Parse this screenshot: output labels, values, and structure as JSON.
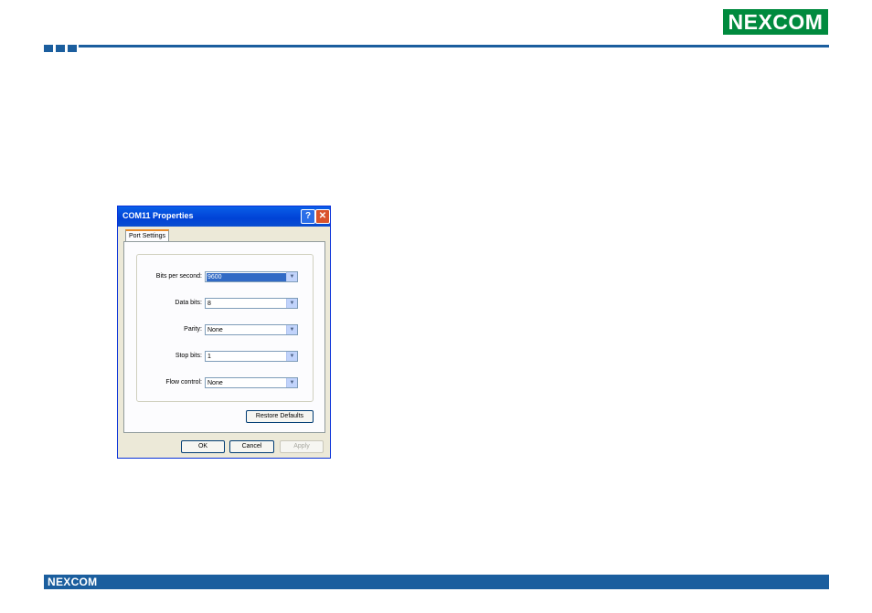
{
  "header": {
    "logo_text": "NEXCOM"
  },
  "footer": {
    "logo_text": "NEXCOM"
  },
  "dialog": {
    "title": "COM11 Properties",
    "help_glyph": "?",
    "close_glyph": "✕",
    "tab_label": "Port Settings",
    "fields": {
      "bits_per_second": {
        "label": "Bits per second:",
        "value": "9600"
      },
      "data_bits": {
        "label": "Data bits:",
        "value": "8"
      },
      "parity": {
        "label": "Parity:",
        "value": "None"
      },
      "stop_bits": {
        "label": "Stop bits:",
        "value": "1"
      },
      "flow_control": {
        "label": "Flow control:",
        "value": "None"
      }
    },
    "restore_defaults_label": "Restore Defaults",
    "ok_label": "OK",
    "cancel_label": "Cancel",
    "apply_label": "Apply"
  },
  "colors": {
    "brand_blue": "#1b5e9e",
    "brand_green": "#008a3e"
  },
  "icons": [
    "chevron-down-icon",
    "help-icon",
    "close-icon"
  ]
}
